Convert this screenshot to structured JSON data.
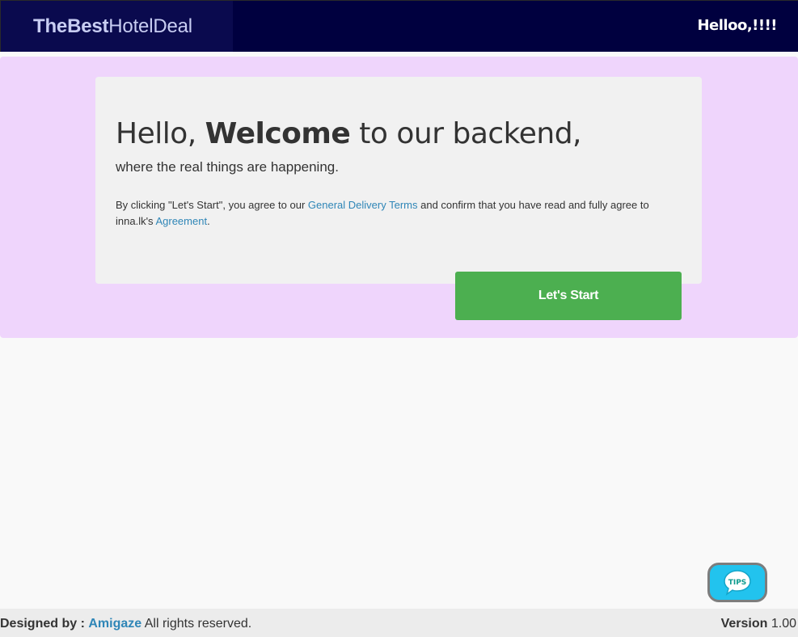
{
  "header": {
    "brand_bold": "TheBest",
    "brand_light": "HotelDeal",
    "greeting": "Helloo,!!!!"
  },
  "welcome": {
    "hello": "Hello,",
    "welcome_word": "Welcome",
    "rest": "to our backend,",
    "subline": "where the real things are happening.",
    "terms_prefix": "By clicking \"Let's Start\", you agree to our",
    "terms_link": "General Delivery Terms",
    "terms_middle": "and confirm that you have read and fully agree to inna.lk's",
    "agreement_link": "Agreement",
    "terms_suffix": "."
  },
  "actions": {
    "start_label": "Let's Start",
    "tips_label": "TIPS"
  },
  "footer": {
    "designed_label": "Designed by :",
    "designer": "Amigaze",
    "rights": "All rights reserved.",
    "version_label": "Version",
    "version_value": "1.00"
  },
  "colors": {
    "header_bg": "#00003f",
    "band_bg": "#efd5fc",
    "card_bg": "#f1f1f1",
    "primary_button": "#4caf50",
    "link": "#2f86b7",
    "tips_bg": "#22c3ee"
  },
  "icons": {
    "tips": "tips-speech-bubble-icon"
  }
}
